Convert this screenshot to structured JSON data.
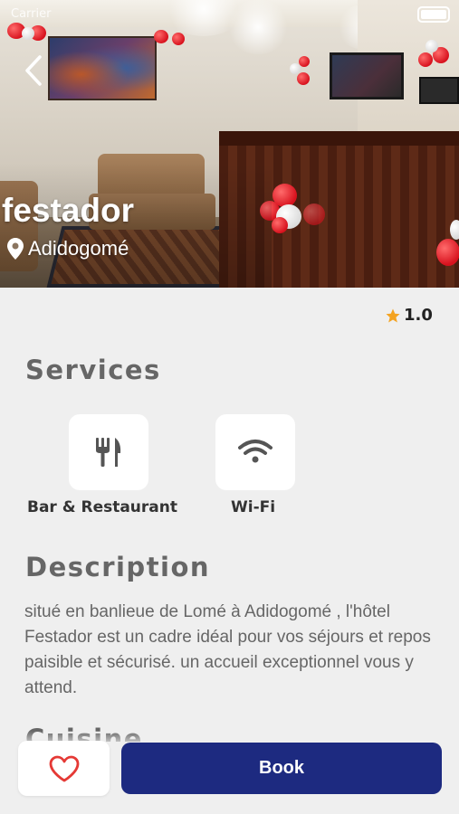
{
  "status_bar": {
    "carrier": "Carrier"
  },
  "hotel": {
    "name": "festador",
    "location": "Adidogomé",
    "rating": "1.0"
  },
  "services": {
    "title": "Services",
    "items": [
      {
        "label": "Bar & Restaurant",
        "icon": "fork-knife-icon"
      },
      {
        "label": "Wi-Fi",
        "icon": "wifi-icon"
      }
    ]
  },
  "description": {
    "title": "Description",
    "text": "situé en banlieue de Lomé à Adidogomé , l'hôtel Festador est un cadre idéal pour vos séjours et repos paisible et sécurisé. un accueil exceptionnel vous y attend."
  },
  "next_section": {
    "title": "Cuisine"
  },
  "actions": {
    "favorite_icon": "heart-icon",
    "book_label": "Book"
  },
  "colors": {
    "accent": "#1d2a80",
    "heart": "#e53935",
    "star": "#f4a321",
    "background": "#efefef"
  }
}
